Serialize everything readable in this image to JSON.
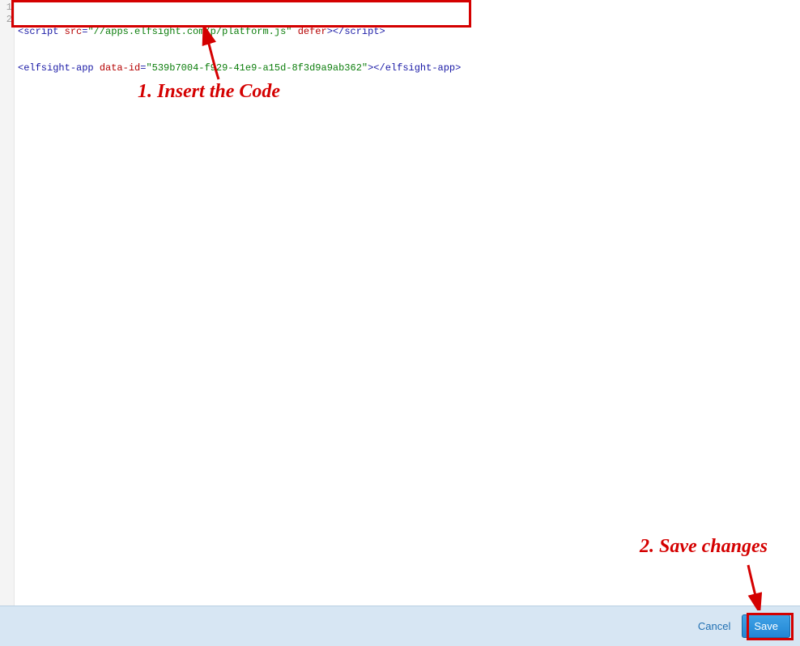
{
  "code": {
    "line_numbers": [
      "1",
      "2"
    ],
    "line1": {
      "p1": "<",
      "p2": "script",
      "p3": " ",
      "p4": "src",
      "p5": "=",
      "p6": "\"//apps.elfsight.com/p/platform.js\"",
      "p7": " ",
      "p8": "defer",
      "p9": "></",
      "p10": "script",
      "p11": ">"
    },
    "line2": {
      "p1": "<",
      "p2": "elfsight-app",
      "p3": " ",
      "p4": "data-id",
      "p5": "=",
      "p6": "\"539b7004-f929-41e9-a15d-8f3d9a9ab362\"",
      "p7": "></",
      "p8": "elfsight-app",
      "p9": ">"
    }
  },
  "footer": {
    "cancel_label": "Cancel",
    "save_label": "Save"
  },
  "annotations": {
    "step1": "1. Insert the Code",
    "step2": "2. Save changes"
  }
}
